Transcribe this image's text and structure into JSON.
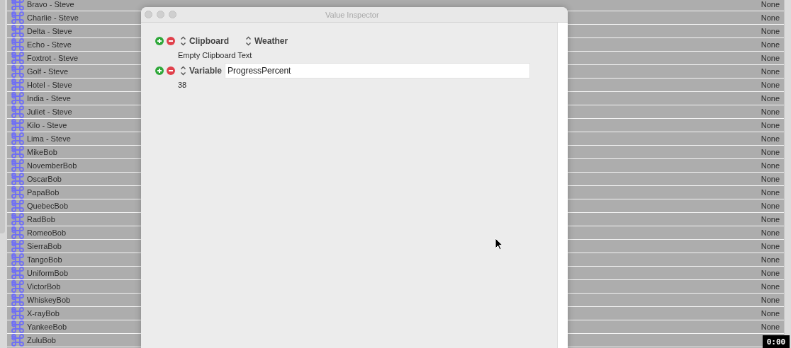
{
  "list": {
    "rows": [
      {
        "name": "Bravo - Steve",
        "value": "None"
      },
      {
        "name": "Charlie - Steve",
        "value": "None"
      },
      {
        "name": "Delta - Steve",
        "value": "None"
      },
      {
        "name": "Echo - Steve",
        "value": "None"
      },
      {
        "name": "Foxtrot - Steve",
        "value": "None"
      },
      {
        "name": "Golf - Steve",
        "value": "None"
      },
      {
        "name": "Hotel - Steve",
        "value": "None"
      },
      {
        "name": "India - Steve",
        "value": "None"
      },
      {
        "name": "Juliet - Steve",
        "value": "None"
      },
      {
        "name": "Kilo - Steve",
        "value": "None"
      },
      {
        "name": "Lima - Steve",
        "value": "None"
      },
      {
        "name": "MikeBob",
        "value": "None"
      },
      {
        "name": "NovemberBob",
        "value": "None"
      },
      {
        "name": "OscarBob",
        "value": "None"
      },
      {
        "name": "PapaBob",
        "value": "None"
      },
      {
        "name": "QuebecBob",
        "value": "None"
      },
      {
        "name": "RadBob",
        "value": "None"
      },
      {
        "name": "RomeoBob",
        "value": "None"
      },
      {
        "name": "SierraBob",
        "value": "None"
      },
      {
        "name": "TangoBob",
        "value": "None"
      },
      {
        "name": "UniformBob",
        "value": "None"
      },
      {
        "name": "VictorBob",
        "value": "None"
      },
      {
        "name": "WhiskeyBob",
        "value": "None"
      },
      {
        "name": "X-rayBob",
        "value": "None"
      },
      {
        "name": "YankeeBob",
        "value": "None"
      },
      {
        "name": "ZuluBob"
      }
    ]
  },
  "inspector": {
    "title": "Value Inspector",
    "entries": [
      {
        "selectors": [
          "Clipboard",
          "Weather"
        ],
        "result": "Empty Clipboard Text"
      },
      {
        "selectors": [
          "Variable"
        ],
        "field": "ProgressPercent",
        "result": "38"
      }
    ]
  },
  "timestamp": "0:00"
}
